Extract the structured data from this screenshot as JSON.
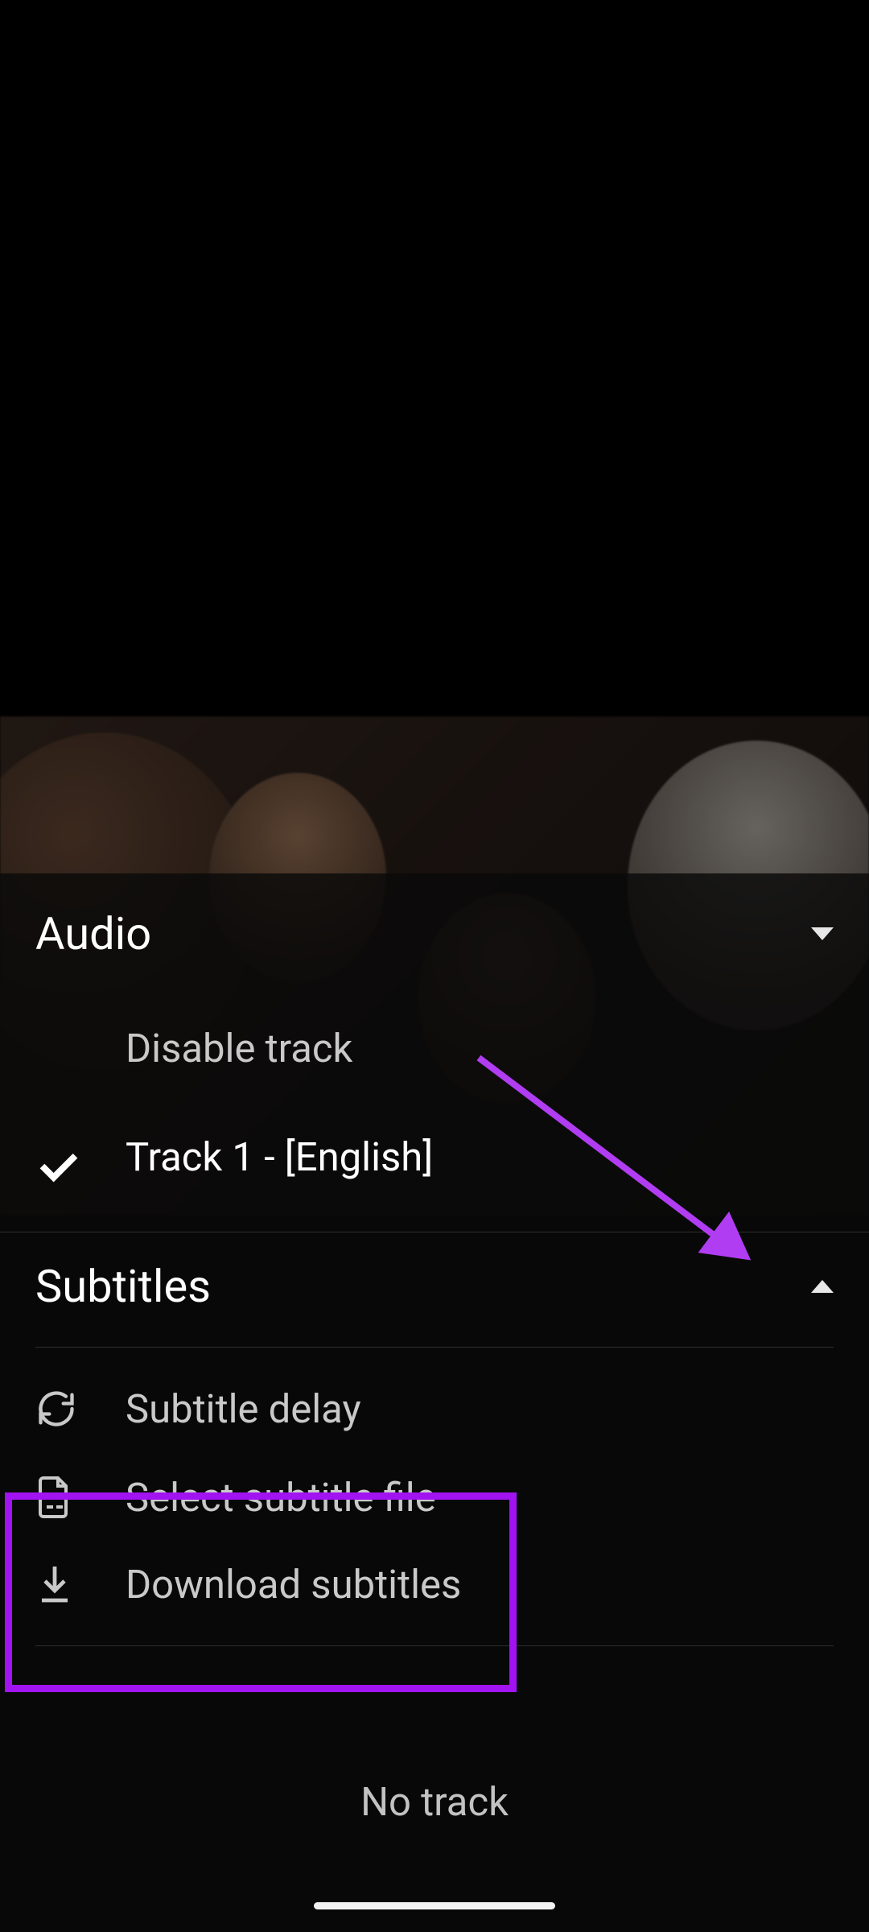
{
  "audio": {
    "header": "Audio",
    "disable": "Disable track",
    "selected": "Track 1 - [English]"
  },
  "subtitles": {
    "header": "Subtitles",
    "delay": "Subtitle delay",
    "select_file": "Select subtitle file",
    "download": "Download subtitles",
    "no_track": "No track"
  }
}
